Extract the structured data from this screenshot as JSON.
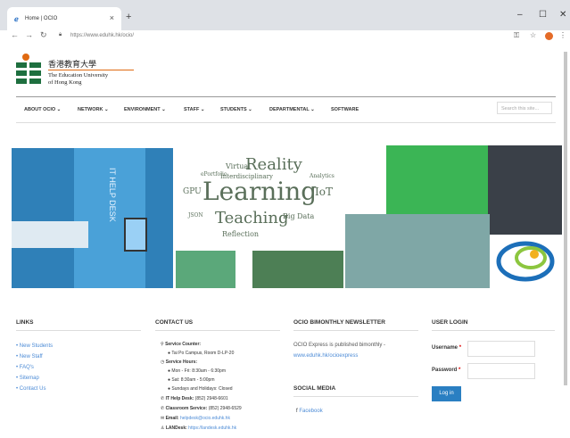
{
  "browser": {
    "tab_title": "Home | OCIO",
    "new_tab": "+",
    "url": "https://www.eduhk.hk/ocio/",
    "window_controls": [
      "–",
      "☐",
      "✕"
    ]
  },
  "logo": {
    "zh": "香港教育大學",
    "en_line1": "The Education University",
    "en_line2": "of Hong Kong"
  },
  "menu": {
    "items": [
      "ABOUT OCIO ⌄",
      "NETWORK ⌄",
      "ENVIRONMENT ⌄",
      "STAFF ⌄",
      "STUDENTS ⌄",
      "DEPARTMENTAL ⌄",
      "SOFTWARE"
    ],
    "search_placeholder": "Search this site..."
  },
  "banner": {
    "it_help_desk_text": "IT HELP DESK",
    "word_cloud": [
      "Reality",
      "Learning",
      "Teaching",
      "Virtual",
      "GPU",
      "IoT",
      "Big Data",
      "Reflection",
      "Interdisciplinary",
      "ePortfolio",
      "Analytics",
      "JSON"
    ]
  },
  "footer": {
    "links": {
      "heading": "LINKS",
      "items": [
        "New Students",
        "New Staff",
        "FAQ's",
        "Sitemap",
        "Contact Us"
      ]
    },
    "contact": {
      "heading": "CONTACT US",
      "service_counter_label": "Service Counter:",
      "service_counter_value": "Tai Po Campus, Room D-LP-20",
      "service_hours_label": "Service Hours:",
      "hours_weekday": "Mon - Fri: 8:30am - 6:30pm",
      "hours_saturday": "Sat: 8:30am - 5:00pm",
      "hours_closed": "Sundays and Holidays: Closed",
      "help_desk_label": "IT Help Desk:",
      "help_desk_value": "(852) 2948-6601",
      "classroom_label": "Classroom Service:",
      "classroom_value": "(852) 2948-6529",
      "email_label": "Email:",
      "email_value": "helpdesk@ocio.eduhk.hk",
      "landesk_label": "LANDesk:",
      "landesk_value": "https://landesk.eduhk.hk"
    },
    "newsletter": {
      "heading": "OCIO BIMONTHLY NEWSLETTER",
      "text": "OCIO Express is published bimonthly -",
      "link": "www.eduhk.hk/ocioexpress"
    },
    "social": {
      "heading": "SOCIAL MEDIA",
      "facebook": "Facebook"
    },
    "login": {
      "heading": "USER LOGIN",
      "username_label": "Username",
      "password_label": "Password",
      "required_mark": "*",
      "button": "Log in"
    }
  },
  "colors": {
    "accent": "#2a7fc2",
    "brand_green": "#1e6f3f",
    "brand_orange": "#e06a12",
    "link": "#4c8bd6"
  }
}
